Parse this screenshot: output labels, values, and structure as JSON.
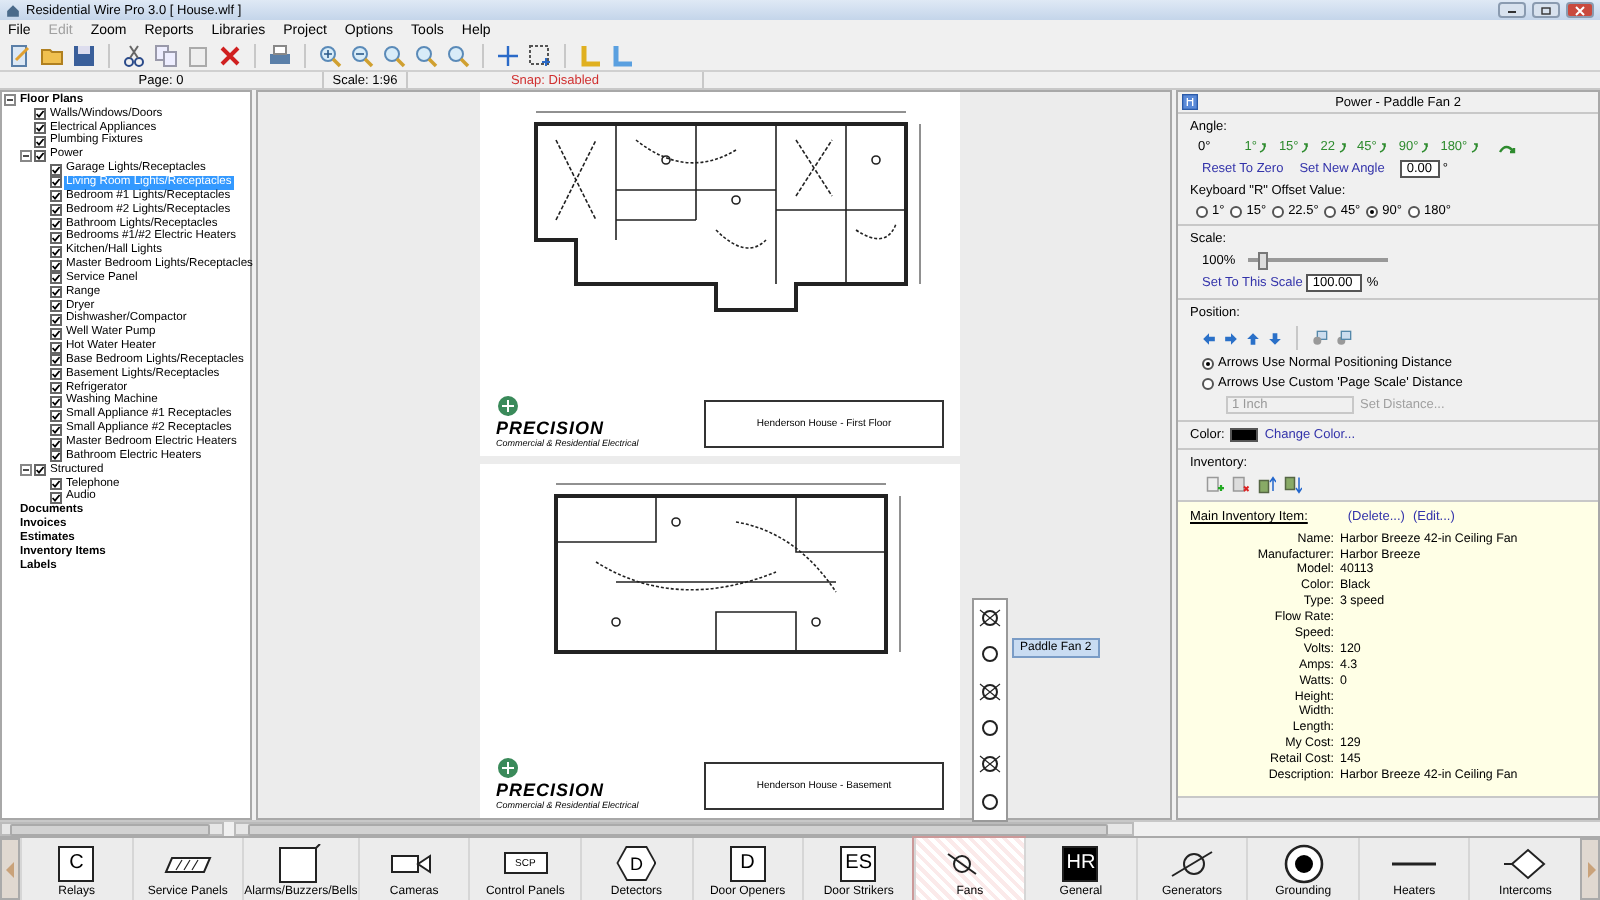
{
  "window": {
    "title": "Residential Wire Pro 3.0 [ House.wlf ]"
  },
  "menu": [
    {
      "label": "File",
      "disabled": false
    },
    {
      "label": "Edit",
      "disabled": true
    },
    {
      "label": "Zoom",
      "disabled": false
    },
    {
      "label": "Reports",
      "disabled": false
    },
    {
      "label": "Libraries",
      "disabled": false
    },
    {
      "label": "Project",
      "disabled": false
    },
    {
      "label": "Options",
      "disabled": false
    },
    {
      "label": "Tools",
      "disabled": false
    },
    {
      "label": "Help",
      "disabled": false
    }
  ],
  "status_bar": {
    "page": "Page: 0",
    "scale": "Scale: 1:96",
    "snap": "Snap: Disabled"
  },
  "tree": [
    {
      "label": "Floor Plans",
      "kind": "section",
      "selected": false,
      "expanded": true,
      "children": [
        {
          "label": "Walls/Windows/Doors",
          "kind": "layer",
          "checked": true,
          "selected": false
        },
        {
          "label": "Electrical Appliances",
          "kind": "layer",
          "checked": true,
          "selected": false
        },
        {
          "label": "Plumbing Fixtures",
          "kind": "layer",
          "checked": true,
          "selected": false
        },
        {
          "label": "Power",
          "kind": "layer",
          "checked": true,
          "selected": false,
          "expanded": true,
          "children": [
            {
              "label": "Garage Lights/Receptacles",
              "kind": "layer",
              "checked": true,
              "selected": false
            },
            {
              "label": "Living Room Lights/Receptacles",
              "kind": "layer",
              "checked": true,
              "selected": true
            },
            {
              "label": "Bedroom #1 Lights/Receptacles",
              "kind": "layer",
              "checked": true,
              "selected": false
            },
            {
              "label": "Bedroom #2 Lights/Receptacles",
              "kind": "layer",
              "checked": true,
              "selected": false
            },
            {
              "label": "Bathroom Lights/Receptacles",
              "kind": "layer",
              "checked": true,
              "selected": false
            },
            {
              "label": "Bedrooms #1/#2 Electric Heaters",
              "kind": "layer",
              "checked": true,
              "selected": false
            },
            {
              "label": "Kitchen/Hall Lights",
              "kind": "layer",
              "checked": true,
              "selected": false
            },
            {
              "label": "Master Bedroom Lights/Receptacles",
              "kind": "layer",
              "checked": true,
              "selected": false
            },
            {
              "label": "Service Panel",
              "kind": "layer",
              "checked": true,
              "selected": false
            },
            {
              "label": "Range",
              "kind": "layer",
              "checked": true,
              "selected": false
            },
            {
              "label": "Dryer",
              "kind": "layer",
              "checked": true,
              "selected": false
            },
            {
              "label": "Dishwasher/Compactor",
              "kind": "layer",
              "checked": true,
              "selected": false
            },
            {
              "label": "Well Water Pump",
              "kind": "layer",
              "checked": true,
              "selected": false
            },
            {
              "label": "Hot Water Heater",
              "kind": "layer",
              "checked": true,
              "selected": false
            },
            {
              "label": "Base Bedroom Lights/Receptacles",
              "kind": "layer",
              "checked": true,
              "selected": false
            },
            {
              "label": "Basement Lights/Receptacles",
              "kind": "layer",
              "checked": true,
              "selected": false
            },
            {
              "label": "Refrigerator",
              "kind": "layer",
              "checked": true,
              "selected": false
            },
            {
              "label": "Washing Machine",
              "kind": "layer",
              "checked": true,
              "selected": false
            },
            {
              "label": "Small Appliance #1 Receptacles",
              "kind": "layer",
              "checked": true,
              "selected": false
            },
            {
              "label": "Small Appliance #2 Receptacles",
              "kind": "layer",
              "checked": true,
              "selected": false
            },
            {
              "label": "Master Bedroom Electric Heaters",
              "kind": "layer",
              "checked": true,
              "selected": false
            },
            {
              "label": "Bathroom Electric Heaters",
              "kind": "layer",
              "checked": true,
              "selected": false
            }
          ]
        },
        {
          "label": "Structured",
          "kind": "layer",
          "checked": true,
          "selected": false,
          "expanded": true,
          "children": [
            {
              "label": "Telephone",
              "kind": "layer",
              "checked": true,
              "selected": false
            },
            {
              "label": "Audio",
              "kind": "layer",
              "checked": true,
              "selected": false
            }
          ]
        }
      ]
    },
    {
      "label": "Documents",
      "kind": "section",
      "selected": false
    },
    {
      "label": "Invoices",
      "kind": "section",
      "selected": false
    },
    {
      "label": "Estimates",
      "kind": "section",
      "selected": false
    },
    {
      "label": "Inventory Items",
      "kind": "section",
      "selected": false
    },
    {
      "label": "Labels",
      "kind": "section",
      "selected": false
    }
  ],
  "sheets": [
    {
      "company": "PRECISION",
      "tagline": "Commercial & Residential Electrical",
      "caption": "Henderson House - First Floor",
      "kind": "first-floor"
    },
    {
      "company": "PRECISION",
      "tagline": "Commercial & Residential Electrical",
      "caption": "Henderson House - Basement",
      "kind": "basement"
    }
  ],
  "tooltip": "Paddle Fan 2",
  "properties": {
    "title": "Power - Paddle Fan 2",
    "angle": {
      "label": "Angle:",
      "current": "0°",
      "presets": [
        "1°",
        "15°",
        "22",
        "45°",
        "90°",
        "180°"
      ],
      "reset": "Reset To Zero",
      "set": "Set New Angle",
      "value": "0.00",
      "unit": "°"
    },
    "offset": {
      "label": "Keyboard \"R\" Offset Value:",
      "options": [
        {
          "label": "1°",
          "selected": false
        },
        {
          "label": "15°",
          "selected": false
        },
        {
          "label": "22.5°",
          "selected": false
        },
        {
          "label": "45°",
          "selected": false
        },
        {
          "label": "90°",
          "selected": true
        },
        {
          "label": "180°",
          "selected": false
        }
      ]
    },
    "scale": {
      "label": "Scale:",
      "reading": "100%",
      "level": 0.1,
      "set": "Set To This Scale",
      "value": "100.00",
      "unit": "%"
    },
    "position": {
      "label": "Position:",
      "options": [
        {
          "label": "Arrows Use Normal Positioning Distance",
          "selected": true
        },
        {
          "label": "Arrows Use Custom 'Page Scale' Distance",
          "selected": false
        }
      ],
      "distance": "1 Inch",
      "set_distance": "Set Distance...",
      "disabled": true
    },
    "color": {
      "label": "Color:",
      "color": "#000000",
      "change": "Change Color..."
    },
    "inventory": {
      "label": "Inventory:",
      "main": "Main Inventory Item:",
      "delete": "(Delete...)",
      "edit": "(Edit...)",
      "fields": [
        {
          "label": "Name:",
          "value": "Harbor Breeze 42-in Ceiling Fan"
        },
        {
          "label": "Manufacturer:",
          "value": "Harbor Breeze"
        },
        {
          "label": "Model:",
          "value": "40113"
        },
        {
          "label": "Color:",
          "value": "Black"
        },
        {
          "label": "Type:",
          "value": "3 speed"
        },
        {
          "label": "Flow Rate:"
        },
        {
          "label": "Speed:"
        },
        {
          "label": "Volts:",
          "value": "120"
        },
        {
          "label": "Amps:",
          "value": "4.3"
        },
        {
          "label": "Watts:",
          "value": "0"
        },
        {
          "label": "Height:"
        },
        {
          "label": "Width:"
        },
        {
          "label": "Length:"
        },
        {
          "label": "My Cost:",
          "value": "129"
        },
        {
          "label": "Retail Cost:",
          "value": "145"
        },
        {
          "label": "Description:",
          "value": "Harbor Breeze 42-in Ceiling Fan"
        }
      ]
    }
  },
  "palette": [
    {
      "label": "Relays",
      "kind": "letter",
      "symbol": "C",
      "selected": false
    },
    {
      "label": "Service Panels",
      "kind": "panel",
      "selected": false
    },
    {
      "label": "Alarms/Buzzers/Bells",
      "kind": "bell",
      "selected": false
    },
    {
      "label": "Cameras",
      "kind": "camera",
      "selected": false
    },
    {
      "label": "Control Panels",
      "kind": "small-box",
      "symbol": "SCP",
      "selected": false
    },
    {
      "label": "Detectors",
      "kind": "hexagon",
      "symbol": "D",
      "selected": false
    },
    {
      "label": "Door Openers",
      "kind": "letter",
      "symbol": "D",
      "selected": false
    },
    {
      "label": "Door Strikers",
      "kind": "letter",
      "symbol": "ES",
      "selected": false
    },
    {
      "label": "Fans",
      "kind": "fan",
      "selected": true
    },
    {
      "label": "General",
      "kind": "inverse",
      "symbol": "HR",
      "selected": false
    },
    {
      "label": "Generators",
      "kind": "generator",
      "selected": false
    },
    {
      "label": "Grounding",
      "kind": "grounding",
      "selected": false
    },
    {
      "label": "Heaters",
      "kind": "heater",
      "selected": false
    },
    {
      "label": "Intercoms",
      "kind": "diamond",
      "selected": false
    }
  ]
}
